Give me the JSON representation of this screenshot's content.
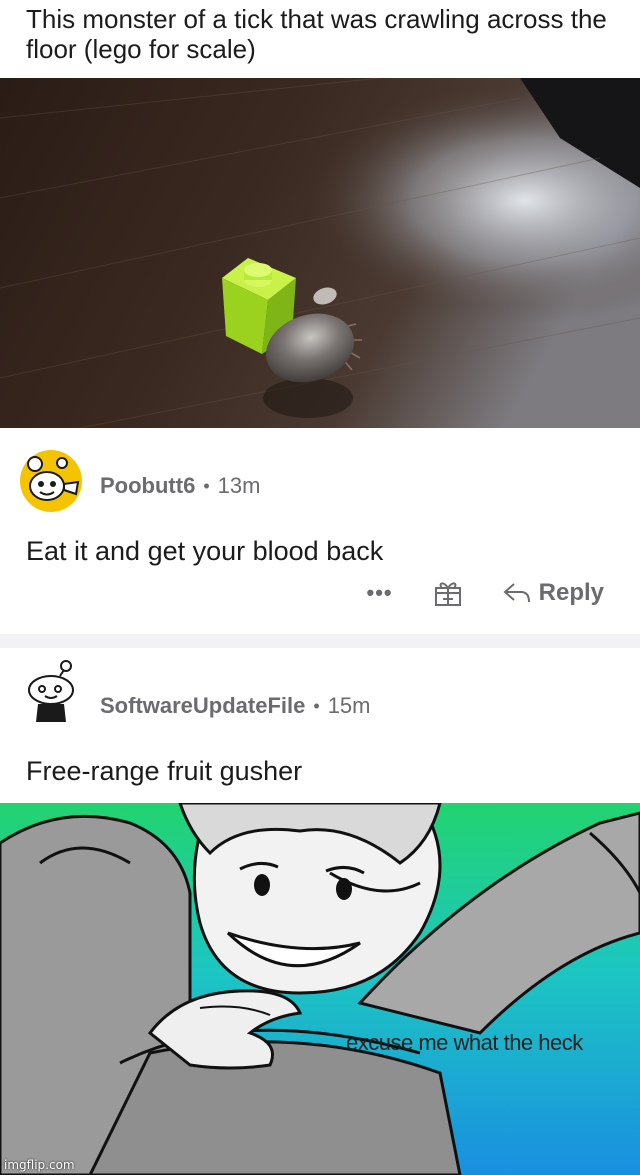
{
  "post": {
    "title": "This monster of a tick that was crawling across the floor (lego for scale)"
  },
  "comments": [
    {
      "username": "Poobutt6",
      "separator": "•",
      "time": "13m",
      "body": "Eat it and get your blood back",
      "more_label": "•••",
      "reply_label": "Reply"
    },
    {
      "username": "SoftwareUpdateFile",
      "separator": "•",
      "time": "15m",
      "body": "Free-range fruit gusher"
    }
  ],
  "meme": {
    "caption": "excuse me what the heck",
    "watermark": "imgflip.com"
  },
  "colors": {
    "meta_gray": "#6b6b70",
    "divider": "#f2f2f4",
    "avatar1_bg": "#f5c400",
    "lego_green": "#a6e22e",
    "meme_green": "#22d36f",
    "meme_blue": "#1aa0e6"
  }
}
